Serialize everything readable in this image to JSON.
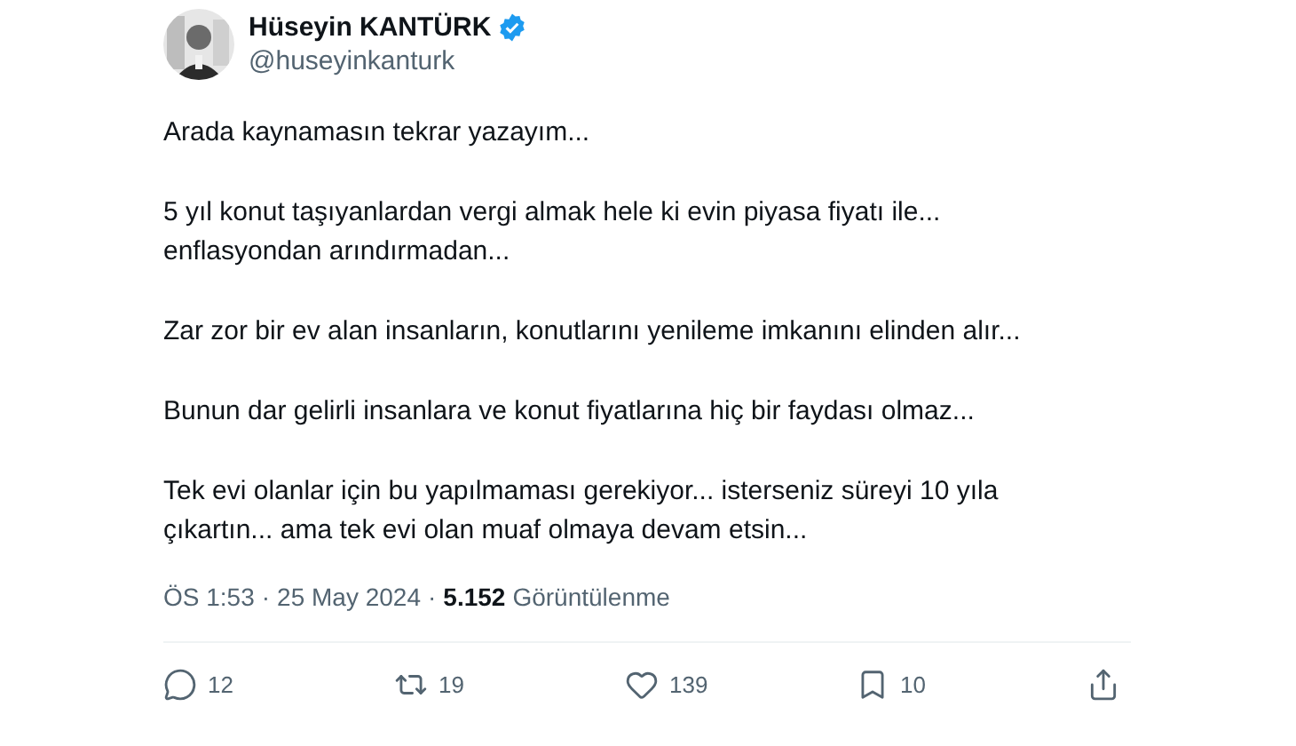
{
  "author": {
    "name": "Hüseyin KANTÜRK",
    "verified": true,
    "handle": "@huseyinkanturk"
  },
  "paragraphs": [
    "Arada kaynamasın tekrar yazayım...",
    "5 yıl konut taşıyanlardan vergi almak hele ki evin piyasa fiyatı ile... enflasyondan arındırmadan...",
    "Zar zor bir ev alan insanların, konutlarını yenileme imkanını elinden alır...",
    "Bunun dar gelirli insanlara ve konut fiyatlarına hiç bir faydası olmaz...",
    "Tek evi olanlar için bu yapılmaması gerekiyor... isterseniz süreyi 10 yıla çıkartın... ama tek evi olan muaf olmaya devam etsin..."
  ],
  "meta": {
    "time": "ÖS 1:53",
    "separator": "·",
    "date": "25 May 2024",
    "views": "5.152",
    "views_label": "Görüntülenme"
  },
  "actions": [
    {
      "kind": "reply",
      "count": "12"
    },
    {
      "kind": "retweet",
      "count": "19"
    },
    {
      "kind": "like",
      "count": "139"
    },
    {
      "kind": "bookmark",
      "count": "10"
    },
    {
      "kind": "share"
    }
  ]
}
